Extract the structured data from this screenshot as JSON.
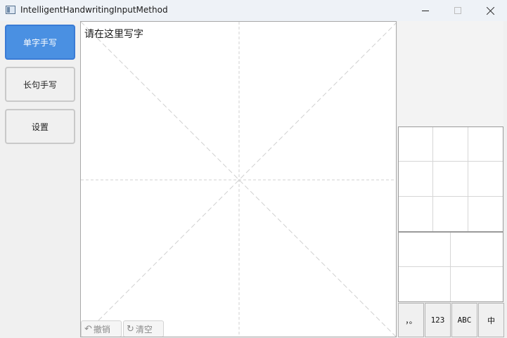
{
  "window": {
    "title": "IntelligentHandwritingInputMethod",
    "icon": "app-window-icon"
  },
  "sidebar": {
    "items": [
      {
        "label": "单字手写",
        "active": true
      },
      {
        "label": "长句手写",
        "active": false
      },
      {
        "label": "设置",
        "active": false
      }
    ]
  },
  "canvas": {
    "prompt": "请在这里写字",
    "guide_color": "#d0d0d0",
    "undo_label": "撤销",
    "clear_label": "清空"
  },
  "candidates": {
    "top_grid": [
      "",
      "",
      "",
      "",
      "",
      "",
      "",
      "",
      ""
    ],
    "bottom_grid": [
      "",
      "",
      "",
      ""
    ]
  },
  "mode_bar": {
    "punct_label": "，。",
    "number_label": "123",
    "alpha_label": "ABC",
    "chinese_label": "中"
  },
  "colors": {
    "accent": "#4a90e2"
  }
}
